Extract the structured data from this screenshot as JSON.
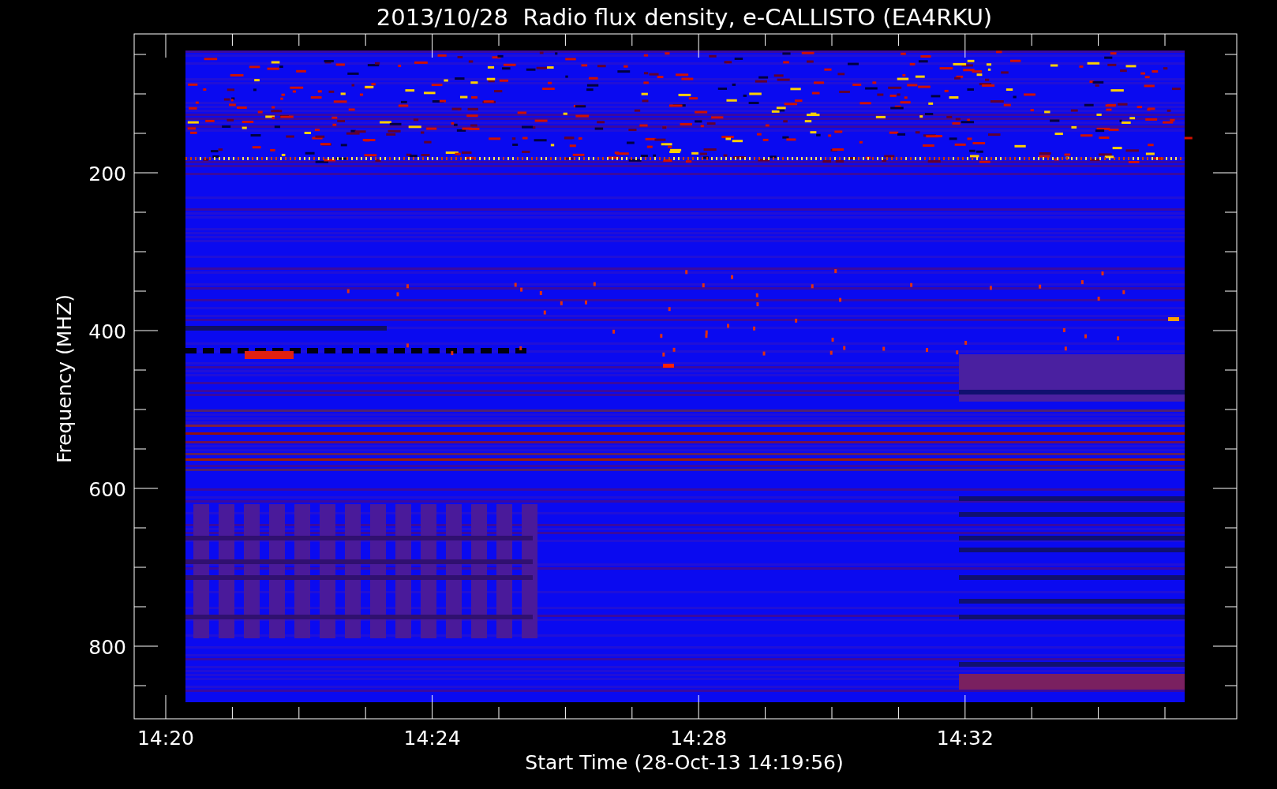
{
  "title": "2013/10/28  Radio flux density, e-CALLISTO (EA4RKU)",
  "y_axis": {
    "label": "Frequency (MHZ)",
    "ticks": [
      "200",
      "400",
      "600",
      "800"
    ]
  },
  "x_axis": {
    "label": "Start Time (28-Oct-13 14:19:56)",
    "ticks": [
      "14:20",
      "14:24",
      "14:28",
      "14:32"
    ]
  }
}
